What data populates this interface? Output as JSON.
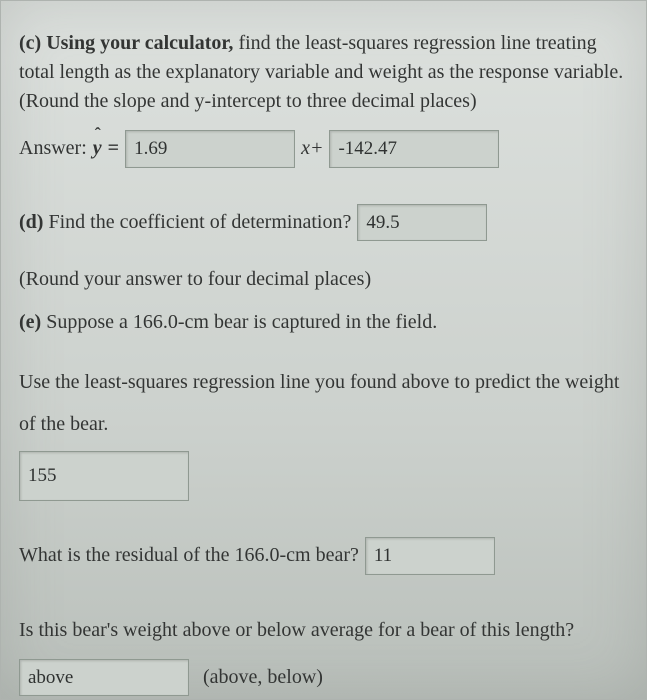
{
  "c": {
    "label": "(c) Using your calculator,",
    "prompt_rest": " find the least-squares regression line treating total length as the explanatory variable and weight as the response variable. (Round the slope and y-intercept to three decimal places)",
    "answer_label": "Answer:",
    "yhat": "y",
    "equals": "=",
    "slope_value": "1.69",
    "x_plus": "x+",
    "intercept_value": "-142.47"
  },
  "d": {
    "label": "(d)",
    "prompt": " Find the coefficient of determination?",
    "value": "49.5",
    "round_note": "(Round your answer to four decimal places)"
  },
  "e": {
    "label": "(e)",
    "prompt": " Suppose a 166.0-cm bear is captured in the field.",
    "use_line": "Use the least-squares regression line you found above to predict the weight of the bear.",
    "predicted_value": "155",
    "residual_prompt": "What is the residual of the 166.0-cm bear?",
    "residual_value": "11",
    "above_below_prompt": "Is this bear's weight above or below average for a bear of this length?",
    "above_below_value": "above",
    "above_below_hint": "(above, below)"
  }
}
